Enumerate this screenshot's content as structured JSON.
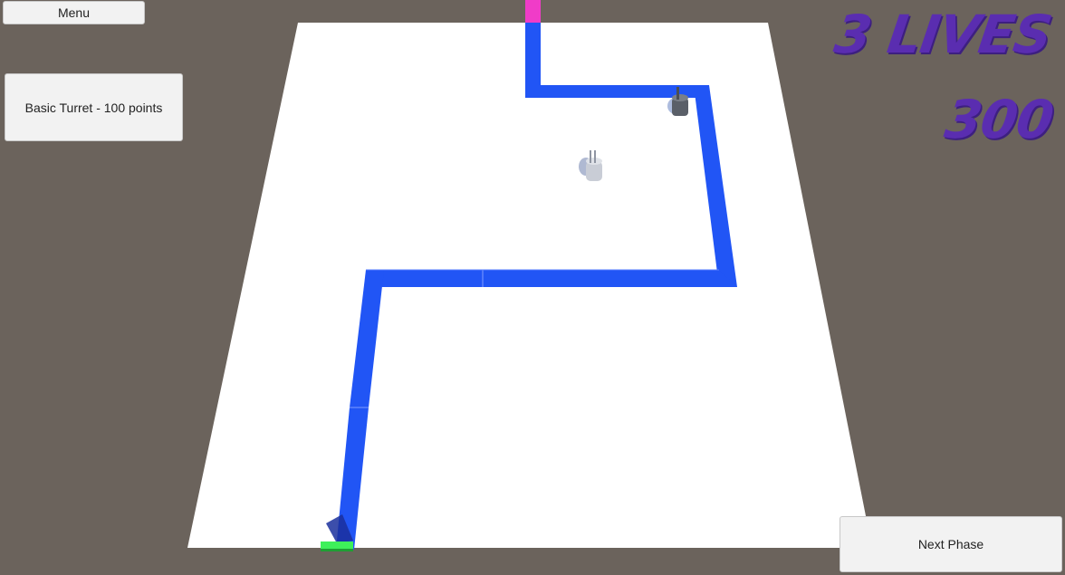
{
  "ui": {
    "menu_label": "Menu",
    "turret_label": "Basic Turret - 100 points",
    "next_phase_label": "Next Phase"
  },
  "hud": {
    "lives_text": "3 LIVES",
    "score_text": "300"
  },
  "colors": {
    "background": "#6b635c",
    "board": "#ffffff",
    "path": "#2155f5",
    "spawn": "#f03cc8",
    "goal": "#3ef05a",
    "hud_text": "#5a2db0"
  }
}
